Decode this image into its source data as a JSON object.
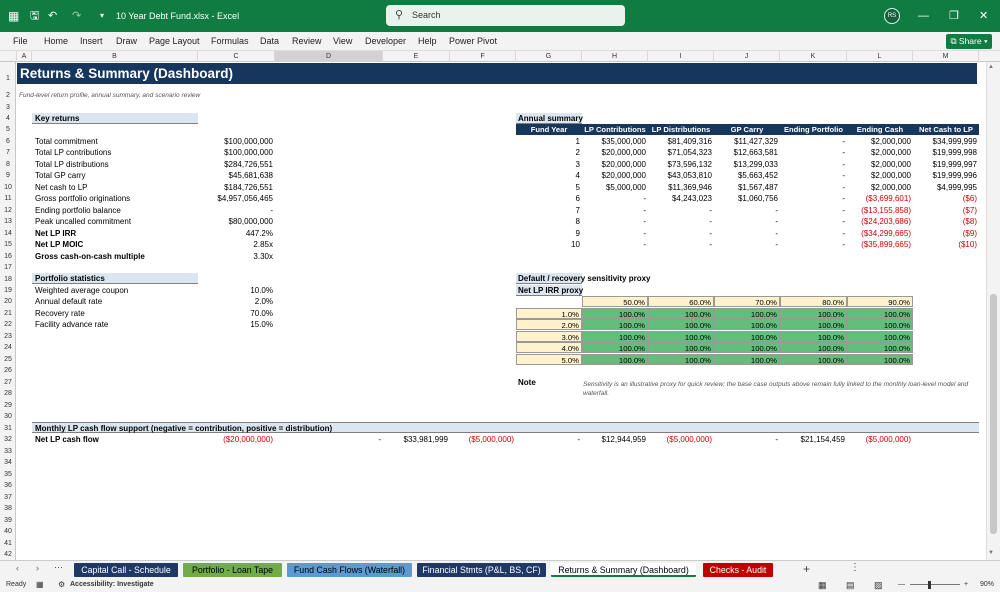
{
  "app": {
    "file_title": "10 Year Debt Fund.xlsx  -  Excel",
    "search_placeholder": "Search",
    "user_initials": "RS",
    "share_label": "Share",
    "menu": [
      "File",
      "Home",
      "Insert",
      "Draw",
      "Page Layout",
      "Formulas",
      "Data",
      "Review",
      "View",
      "Developer",
      "Help",
      "Power Pivot"
    ]
  },
  "columns": [
    "A",
    "B",
    "C",
    "D",
    "E",
    "F",
    "G",
    "H",
    "I",
    "J",
    "K",
    "L",
    "M"
  ],
  "rows": [
    "1",
    "2",
    "3",
    "4",
    "5",
    "6",
    "7",
    "8",
    "9",
    "10",
    "11",
    "12",
    "13",
    "14",
    "15",
    "16",
    "17",
    "18",
    "19",
    "20",
    "21",
    "22",
    "23",
    "24",
    "25",
    "26",
    "27",
    "28",
    "29",
    "30",
    "31",
    "32",
    "33",
    "34",
    "35",
    "36",
    "37",
    "38",
    "39",
    "40",
    "41",
    "42"
  ],
  "sheet": {
    "title": "Returns & Summary (Dashboard)",
    "subtitle": "Fund-level return profile, annual summary, and scenario review",
    "key_returns": {
      "header": "Key returns",
      "rows": [
        {
          "label": "Total commitment",
          "value": "$100,000,000",
          "bold": false
        },
        {
          "label": "Total LP contributions",
          "value": "$100,000,000",
          "bold": false
        },
        {
          "label": "Total LP distributions",
          "value": "$284,726,551",
          "bold": false
        },
        {
          "label": "Total GP carry",
          "value": "$45,681,638",
          "bold": false
        },
        {
          "label": "Net cash to LP",
          "value": "$184,726,551",
          "bold": false
        },
        {
          "label": "Gross portfolio originations",
          "value": "$4,957,056,465",
          "bold": false
        },
        {
          "label": "Ending portfolio balance",
          "value": "-",
          "bold": false
        },
        {
          "label": "Peak uncalled commitment",
          "value": "$80,000,000",
          "bold": false
        },
        {
          "label": "Net LP IRR",
          "value": "447.2%",
          "bold": true
        },
        {
          "label": "Net LP MOIC",
          "value": "2.85x",
          "bold": true
        },
        {
          "label": "Gross cash-on-cash multiple",
          "value": "3.30x",
          "bold": true
        }
      ]
    },
    "portfolio_stats": {
      "header": "Portfolio statistics",
      "rows": [
        {
          "label": "Weighted average coupon",
          "value": "10.0%"
        },
        {
          "label": "Annual default rate",
          "value": "2.0%"
        },
        {
          "label": "Recovery rate",
          "value": "70.0%"
        },
        {
          "label": "Facility advance rate",
          "value": "15.0%"
        }
      ]
    },
    "annual_summary": {
      "header": "Annual summary",
      "columns": [
        "Fund Year",
        "LP Contributions",
        "LP Distributions",
        "GP Carry",
        "Ending Portfolio",
        "Ending Cash",
        "Net Cash to LP"
      ],
      "rows": [
        [
          "1",
          "$35,000,000",
          "$81,409,316",
          "$11,427,329",
          "-",
          "$2,000,000",
          "$34,999,999"
        ],
        [
          "2",
          "$20,000,000",
          "$71,054,323",
          "$12,663,581",
          "-",
          "$2,000,000",
          "$19,999,998"
        ],
        [
          "3",
          "$20,000,000",
          "$73,596,132",
          "$13,299,033",
          "-",
          "$2,000,000",
          "$19,999,997"
        ],
        [
          "4",
          "$20,000,000",
          "$43,053,810",
          "$5,663,452",
          "-",
          "$2,000,000",
          "$19,999,996"
        ],
        [
          "5",
          "$5,000,000",
          "$11,369,946",
          "$1,567,487",
          "-",
          "$2,000,000",
          "$4,999,995"
        ],
        [
          "6",
          "-",
          "$4,243,023",
          "$1,060,756",
          "-",
          "($3,699,601)",
          "($6)"
        ],
        [
          "7",
          "-",
          "-",
          "-",
          "-",
          "($13,155,858)",
          "($7)"
        ],
        [
          "8",
          "-",
          "-",
          "-",
          "-",
          "($24,203,686)",
          "($8)"
        ],
        [
          "9",
          "-",
          "-",
          "-",
          "-",
          "($34,299,665)",
          "($9)"
        ],
        [
          "10",
          "-",
          "-",
          "-",
          "-",
          "($35,899,665)",
          "($10)"
        ]
      ]
    },
    "sensitivity": {
      "header": "Default / recovery sensitivity proxy",
      "subheader": "Net LP IRR proxy",
      "col_values": [
        "50.0%",
        "60.0%",
        "70.0%",
        "80.0%",
        "90.0%"
      ],
      "row_values": [
        "1.0%",
        "2.0%",
        "3.0%",
        "4.0%",
        "5.0%"
      ],
      "cells": [
        [
          "100.0%",
          "100.0%",
          "100.0%",
          "100.0%",
          "100.0%"
        ],
        [
          "100.0%",
          "100.0%",
          "100.0%",
          "100.0%",
          "100.0%"
        ],
        [
          "100.0%",
          "100.0%",
          "100.0%",
          "100.0%",
          "100.0%"
        ],
        [
          "100.0%",
          "100.0%",
          "100.0%",
          "100.0%",
          "100.0%"
        ],
        [
          "100.0%",
          "100.0%",
          "100.0%",
          "100.0%",
          "100.0%"
        ]
      ]
    },
    "note": {
      "label": "Note",
      "text_line1": "Sensitivity is an illustrative proxy for quick review; the base case outputs above remain fully linked to the monthly loan-level model and",
      "text_line2": "waterfall."
    },
    "monthly": {
      "header": "Monthly LP cash flow support (negative = contribution, positive = distribution)",
      "label": "Net LP cash flow",
      "values": [
        "($20,000,000)",
        "-",
        "$33,981,999",
        "($5,000,000)",
        "-",
        "$12,944,959",
        "($5,000,000)",
        "-",
        "$21,154,459",
        "($5,000,000)"
      ]
    }
  },
  "tabs": [
    {
      "label": "Capital Call - Schedule",
      "color": "#1f3864",
      "text": "#ffffff"
    },
    {
      "label": "Portfolio - Loan Tape",
      "color": "#70ad47",
      "text": "#000000"
    },
    {
      "label": "Fund Cash Flows (Waterfall)",
      "color": "#5b9bd5",
      "text": "#000000"
    },
    {
      "label": "Financial Stmts (P&L, BS, CF)",
      "color": "#1f3864",
      "text": "#ffffff"
    },
    {
      "label": "Returns & Summary (Dashboard)",
      "color": "#ffffff",
      "text": "#000000"
    },
    {
      "label": "Checks - Audit",
      "color": "#c00000",
      "text": "#ffffff"
    }
  ],
  "status": {
    "ready": "Ready",
    "accessibility": "Accessibility: Investigate",
    "zoom": "90%"
  }
}
